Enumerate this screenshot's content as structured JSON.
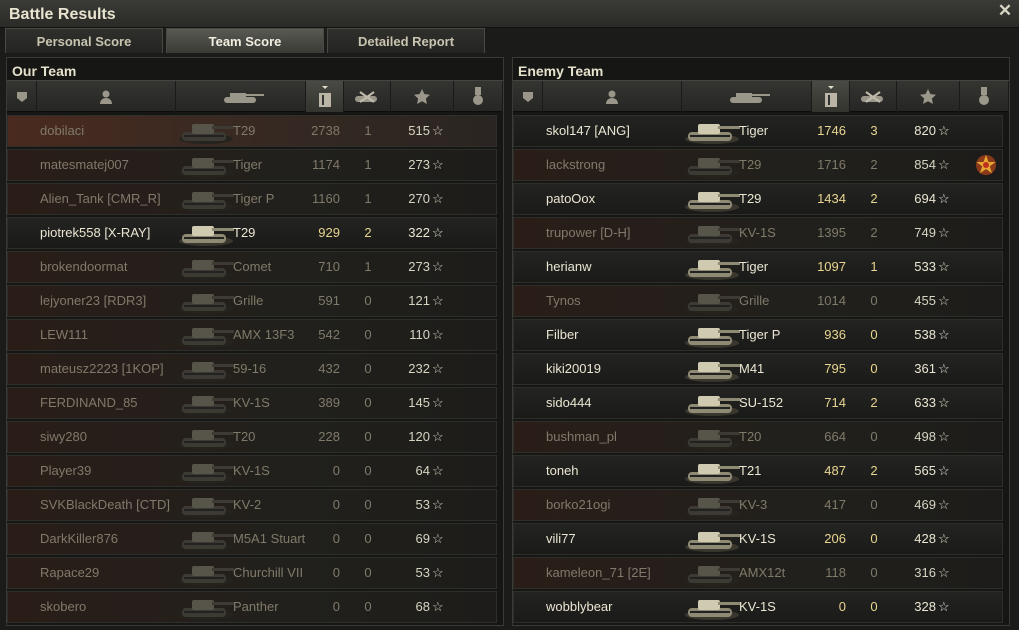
{
  "window": {
    "title": "Battle Results",
    "close_glyph": "✕"
  },
  "tabs": [
    {
      "label": "Personal Score",
      "active": false
    },
    {
      "label": "Team Score",
      "active": true
    },
    {
      "label": "Detailed Report",
      "active": false
    }
  ],
  "columns": [
    "squad-icon",
    "player-icon",
    "vehicle-icon",
    "damage-icon",
    "kills-icon",
    "experience-icon",
    "medal-icon"
  ],
  "sorted_column": "damage",
  "star_glyph": "☆",
  "our_team": {
    "title": "Our Team",
    "players": [
      {
        "name": "dobilaci",
        "tank": "T29",
        "damage": "2738",
        "kills": "1",
        "xp": "515",
        "alive": false,
        "highlight": true
      },
      {
        "name": "matesmatej007",
        "tank": "Tiger",
        "damage": "1174",
        "kills": "1",
        "xp": "273",
        "alive": false
      },
      {
        "name": "Alien_Tank [CMR_R]",
        "tank": "Tiger P",
        "damage": "1160",
        "kills": "1",
        "xp": "270",
        "alive": false
      },
      {
        "name": "piotrek558 [X-RAY]",
        "tank": "T29",
        "damage": "929",
        "kills": "2",
        "xp": "322",
        "alive": true
      },
      {
        "name": "brokendoormat",
        "tank": "Comet",
        "damage": "710",
        "kills": "1",
        "xp": "273",
        "alive": false
      },
      {
        "name": "lejyoner23 [RDR3]",
        "tank": "Grille",
        "damage": "591",
        "kills": "0",
        "xp": "121",
        "alive": false
      },
      {
        "name": "LEW111",
        "tank": "AMX 13F3",
        "damage": "542",
        "kills": "0",
        "xp": "110",
        "alive": false
      },
      {
        "name": "mateusz2223 [1KOP]",
        "tank": "59-16",
        "damage": "432",
        "kills": "0",
        "xp": "232",
        "alive": false
      },
      {
        "name": "FERDINAND_85",
        "tank": "KV-1S",
        "damage": "389",
        "kills": "0",
        "xp": "145",
        "alive": false
      },
      {
        "name": "siwy280",
        "tank": "T20",
        "damage": "228",
        "kills": "0",
        "xp": "120",
        "alive": false
      },
      {
        "name": "Player39",
        "tank": "KV-1S",
        "damage": "0",
        "kills": "0",
        "xp": "64",
        "alive": false
      },
      {
        "name": "SVKBlackDeath [CTD]",
        "tank": "KV-2",
        "damage": "0",
        "kills": "0",
        "xp": "53",
        "alive": false
      },
      {
        "name": "DarkKiller876",
        "tank": "M5A1 Stuart",
        "damage": "0",
        "kills": "0",
        "xp": "69",
        "alive": false
      },
      {
        "name": "Rapace29",
        "tank": "Churchill VII",
        "damage": "0",
        "kills": "0",
        "xp": "53",
        "alive": false
      },
      {
        "name": "skobero",
        "tank": "Panther",
        "damage": "0",
        "kills": "0",
        "xp": "68",
        "alive": false
      }
    ]
  },
  "enemy_team": {
    "title": "Enemy Team",
    "players": [
      {
        "name": "skol147 [ANG]",
        "tank": "Tiger",
        "damage": "1746",
        "kills": "3",
        "xp": "820",
        "alive": true
      },
      {
        "name": "lackstrong",
        "tank": "T29",
        "damage": "1716",
        "kills": "2",
        "xp": "854",
        "alive": false,
        "medal": true
      },
      {
        "name": "patoOox",
        "tank": "T29",
        "damage": "1434",
        "kills": "2",
        "xp": "694",
        "alive": true
      },
      {
        "name": "trupower [D-H]",
        "tank": "KV-1S",
        "damage": "1395",
        "kills": "2",
        "xp": "749",
        "alive": false
      },
      {
        "name": "herianw",
        "tank": "Tiger",
        "damage": "1097",
        "kills": "1",
        "xp": "533",
        "alive": true
      },
      {
        "name": "Tynos",
        "tank": "Grille",
        "damage": "1014",
        "kills": "0",
        "xp": "455",
        "alive": false
      },
      {
        "name": "Filber",
        "tank": "Tiger P",
        "damage": "936",
        "kills": "0",
        "xp": "538",
        "alive": true
      },
      {
        "name": "kiki20019",
        "tank": "M41",
        "damage": "795",
        "kills": "0",
        "xp": "361",
        "alive": true
      },
      {
        "name": "sido444",
        "tank": "SU-152",
        "damage": "714",
        "kills": "2",
        "xp": "633",
        "alive": true
      },
      {
        "name": "bushman_pl",
        "tank": "T20",
        "damage": "664",
        "kills": "0",
        "xp": "498",
        "alive": false
      },
      {
        "name": "toneh",
        "tank": "T21",
        "damage": "487",
        "kills": "2",
        "xp": "565",
        "alive": true
      },
      {
        "name": "borko21ogi",
        "tank": "KV-3",
        "damage": "417",
        "kills": "0",
        "xp": "469",
        "alive": false
      },
      {
        "name": "vili77",
        "tank": "KV-1S",
        "damage": "206",
        "kills": "0",
        "xp": "428",
        "alive": true
      },
      {
        "name": "kameleon_71 [2E]",
        "tank": "AMX12t",
        "damage": "118",
        "kills": "0",
        "xp": "316",
        "alive": false
      },
      {
        "name": "wobblybear",
        "tank": "KV-1S",
        "damage": "0",
        "kills": "0",
        "xp": "328",
        "alive": true
      }
    ]
  }
}
